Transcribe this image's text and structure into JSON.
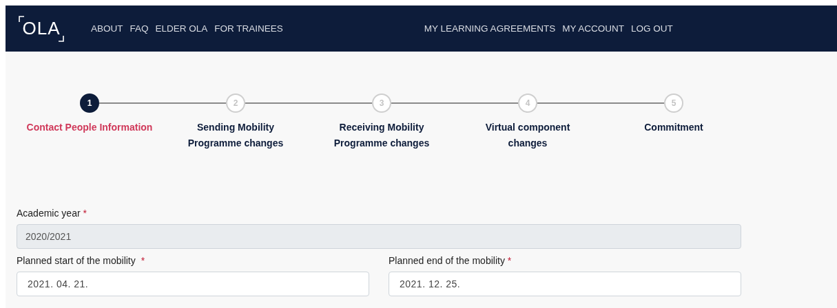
{
  "navbar": {
    "logo": "OLA",
    "left_links": [
      "ABOUT",
      "FAQ",
      "ELDER OLA",
      "FOR TRAINEES"
    ],
    "right_links": [
      "MY LEARNING AGREEMENTS",
      "MY ACCOUNT",
      "LOG OUT"
    ]
  },
  "steps": [
    {
      "number": "1",
      "label": "Contact People Information",
      "selected": true
    },
    {
      "number": "2",
      "label": "Sending Mobility Programme changes",
      "selected": false
    },
    {
      "number": "3",
      "label": "Receiving Mobility Programme changes",
      "selected": false
    },
    {
      "number": "4",
      "label": "Virtual component changes",
      "selected": false
    },
    {
      "number": "5",
      "label": "Commitment",
      "selected": false
    }
  ],
  "form": {
    "academic_year": {
      "label": "Academic year",
      "required_mark": "*",
      "value": "2020/2021",
      "disabled": true
    },
    "dates": [
      {
        "label": "Planned start of the mobility",
        "required_mark": "*",
        "value": "2021. 04. 21.",
        "disabled": false
      },
      {
        "label": "Planned end of the mobility",
        "required_mark": "*",
        "value": "2021. 12. 25.",
        "disabled": false
      }
    ]
  }
}
